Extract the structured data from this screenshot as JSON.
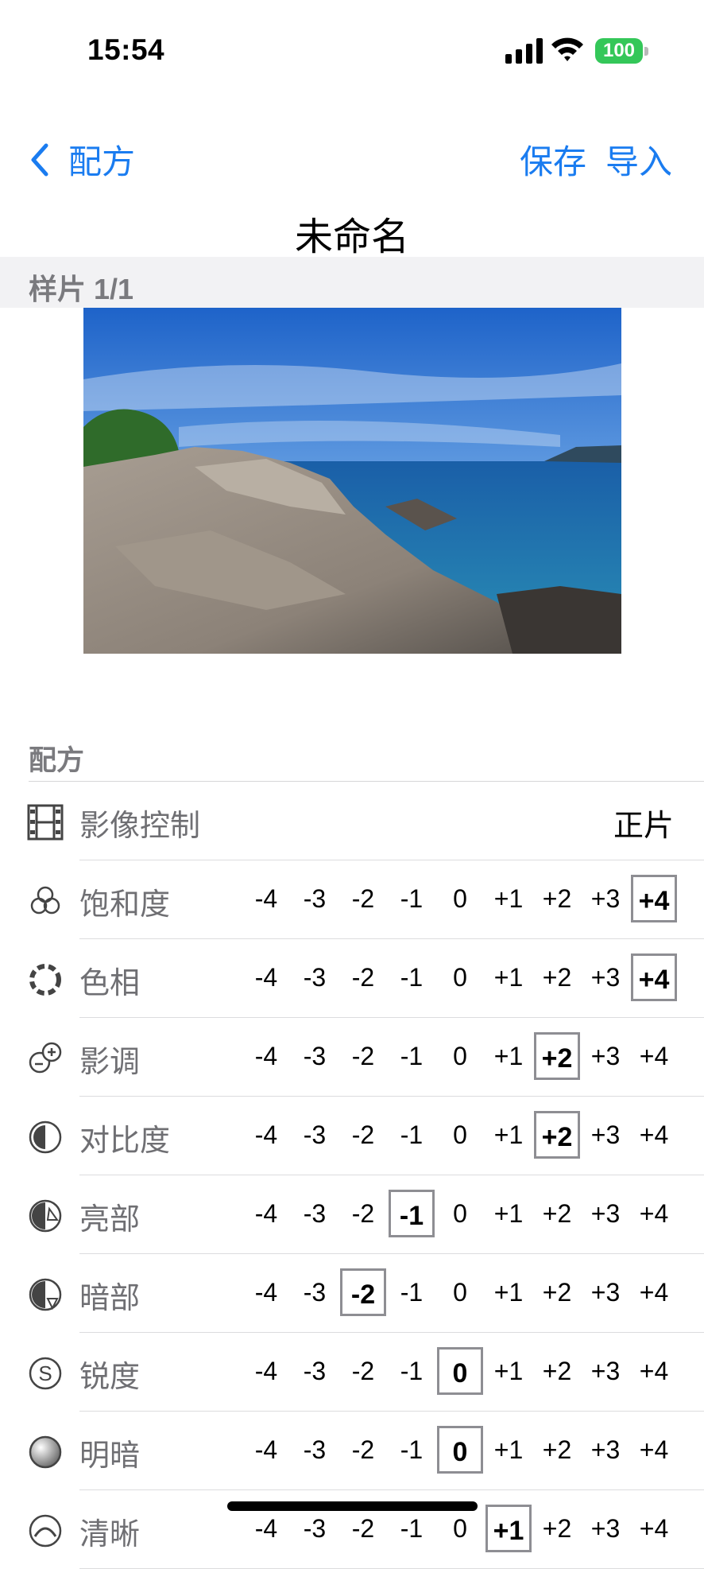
{
  "status": {
    "time": "15:54",
    "battery": "100"
  },
  "nav": {
    "back_label": "配方",
    "save_label": "保存",
    "import_label": "导入"
  },
  "title": "未命名",
  "sample": {
    "label": "样片 1/1"
  },
  "recipe": {
    "section_label": "配方",
    "film": {
      "label": "影像控制",
      "value": "正片",
      "icon": "film-icon"
    },
    "scale_values": [
      "-4",
      "-3",
      "-2",
      "-1",
      "0",
      "+1",
      "+2",
      "+3",
      "+4"
    ],
    "settings": [
      {
        "label": "饱和度",
        "icon": "saturation-icon",
        "selected": "+4"
      },
      {
        "label": "色相",
        "icon": "hue-icon",
        "selected": "+4"
      },
      {
        "label": "影调",
        "icon": "tone-icon",
        "selected": "+2"
      },
      {
        "label": "对比度",
        "icon": "contrast-icon",
        "selected": "+2"
      },
      {
        "label": "亮部",
        "icon": "highlight-icon",
        "selected": "-1"
      },
      {
        "label": "暗部",
        "icon": "shadow-icon",
        "selected": "-2"
      },
      {
        "label": "锐度",
        "icon": "sharpness-icon",
        "selected": "0"
      },
      {
        "label": "明暗",
        "icon": "light-dark-icon",
        "selected": "0"
      },
      {
        "label": "清晰",
        "icon": "clarity-icon",
        "selected": "+1"
      }
    ]
  },
  "colors": {
    "accent": "#1a7cf0",
    "battery": "#34c759",
    "secondary_text": "#6f6f73"
  }
}
